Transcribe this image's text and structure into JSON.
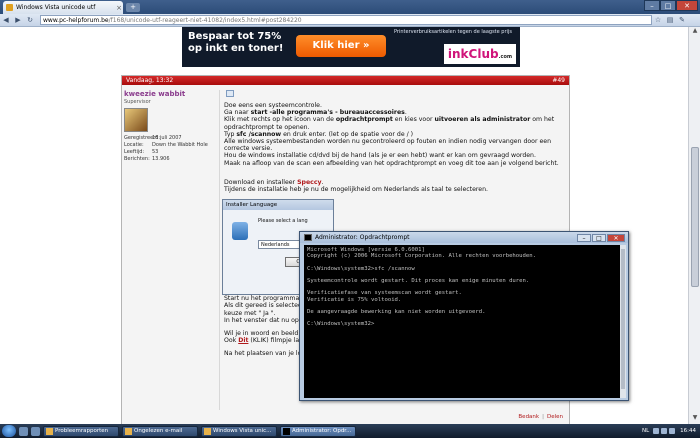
{
  "browser": {
    "tab_title": "Windows Vista unicode utf",
    "new_tab_label": "+",
    "url_host": "www.pc-helpforum.be",
    "url_path": "/f168/unicode-utf-reageert-niet-41082/index5.html#post284220",
    "controls": {
      "minimize": "–",
      "maximize": "□",
      "close": "✕"
    },
    "nav": {
      "back": "◀",
      "forward": "▶",
      "reload": "↻",
      "star": "☆",
      "page": "▤",
      "tools": "✎"
    }
  },
  "banner": {
    "headline": "Bespaar tot 75% op inkt en toner!",
    "cta": "Klik hier »",
    "small_text": "Printerverbruiksartikelen tegen de laagste prijs",
    "logo_main": "ink",
    "logo_accent": "Club",
    "logo_suffix": ".com"
  },
  "post": {
    "date": "Vandaag, 13:32",
    "number": "#49",
    "user": {
      "name": "kweezie wabbit",
      "rank": "Supervisor",
      "info": [
        {
          "key": "Geregistreerd:",
          "value": "16 juli 2007"
        },
        {
          "key": "Locatie:",
          "value": "Down the Wabbit Hole"
        },
        {
          "key": "Leeftijd:",
          "value": "53"
        },
        {
          "key": "Berichten:",
          "value": "13.906"
        }
      ]
    },
    "body": {
      "p1": "Doe eens een systeemcontrole.",
      "p2a": "Ga naar ",
      "p2b": "start -alle programma's - bureauaccessoires",
      "p2c": ".",
      "p3a": "Klik met rechts op het icoon van de ",
      "p3b": "opdrachtprompt",
      "p3c": " en kies voor ",
      "p3d": "uitvoeren als administrator",
      "p3e": " om het opdrachtprompt te openen.",
      "p4a": "Typ ",
      "p4b": "sfc /scannow",
      "p4c": " en druk enter. (let op de spatie voor de / )",
      "p5": "Alle windows systeembestanden worden nu gecontroleerd op fouten en indien nodig vervangen door een correcte versie.",
      "p6": "Hou de windows installatie cd/dvd bij de hand (als je er een hebt) want er kan om gevraagd worden.",
      "p7": "Maak na afloop van de scan een afbeelding van het opdrachtprompt en voeg dit toe aan je volgend bericht.",
      "p8a": "Download en installeer ",
      "p8b": "Speccy",
      "p8c": ".",
      "p9": "Tijdens de installatie heb je nu de mogelijkheid om Nederlands als taal te selecteren.",
      "p10": "Start nu het programma",
      "p11": "Als dit gereed is selecteer",
      "p12": "keuze met \" Ja \".",
      "p13": "In het venster dat nu opk",
      "p14": "Wil je in woord en beeld",
      "p15a": "Ook ",
      "p15b": "Dit",
      "p15c": " (KLIK) filmpje laa",
      "p16": "Na het plaatsen van je lo"
    },
    "footer": {
      "quote": "Bedank",
      "delete": "Delen"
    }
  },
  "installer": {
    "title": "Installer Language",
    "prompt": "Please select a lang",
    "selected": "Nederlands",
    "ok": "OK"
  },
  "cmd": {
    "title": "Administrator: Opdrachtprompt",
    "lines": [
      "Microsoft Windows [versie 6.0.6001]",
      "Copyright (c) 2006 Microsoft Corporation. Alle rechten voorbehouden.",
      "",
      "C:\\Windows\\system32>sfc /scannow",
      "",
      "Systeemcontrole wordt gestart. Dit proces kan enige minuten duren.",
      "",
      "Verificatiefase van systeemscan wordt gestart.",
      "Verificatie is 75% voltooid.",
      "",
      "De aangevraagde bewerking kan niet worden uitgevoerd.",
      "",
      "C:\\Windows\\system32>"
    ]
  },
  "taskbar": {
    "buttons": [
      {
        "label": "Probleemrapporten",
        "active": false
      },
      {
        "label": "Ongelezen e-mail",
        "active": false
      },
      {
        "label": "Windows Vista unic...",
        "active": false
      },
      {
        "label": "Administrator: Opdr...",
        "active": true
      }
    ],
    "lang": "NL",
    "clock": "16:44"
  }
}
